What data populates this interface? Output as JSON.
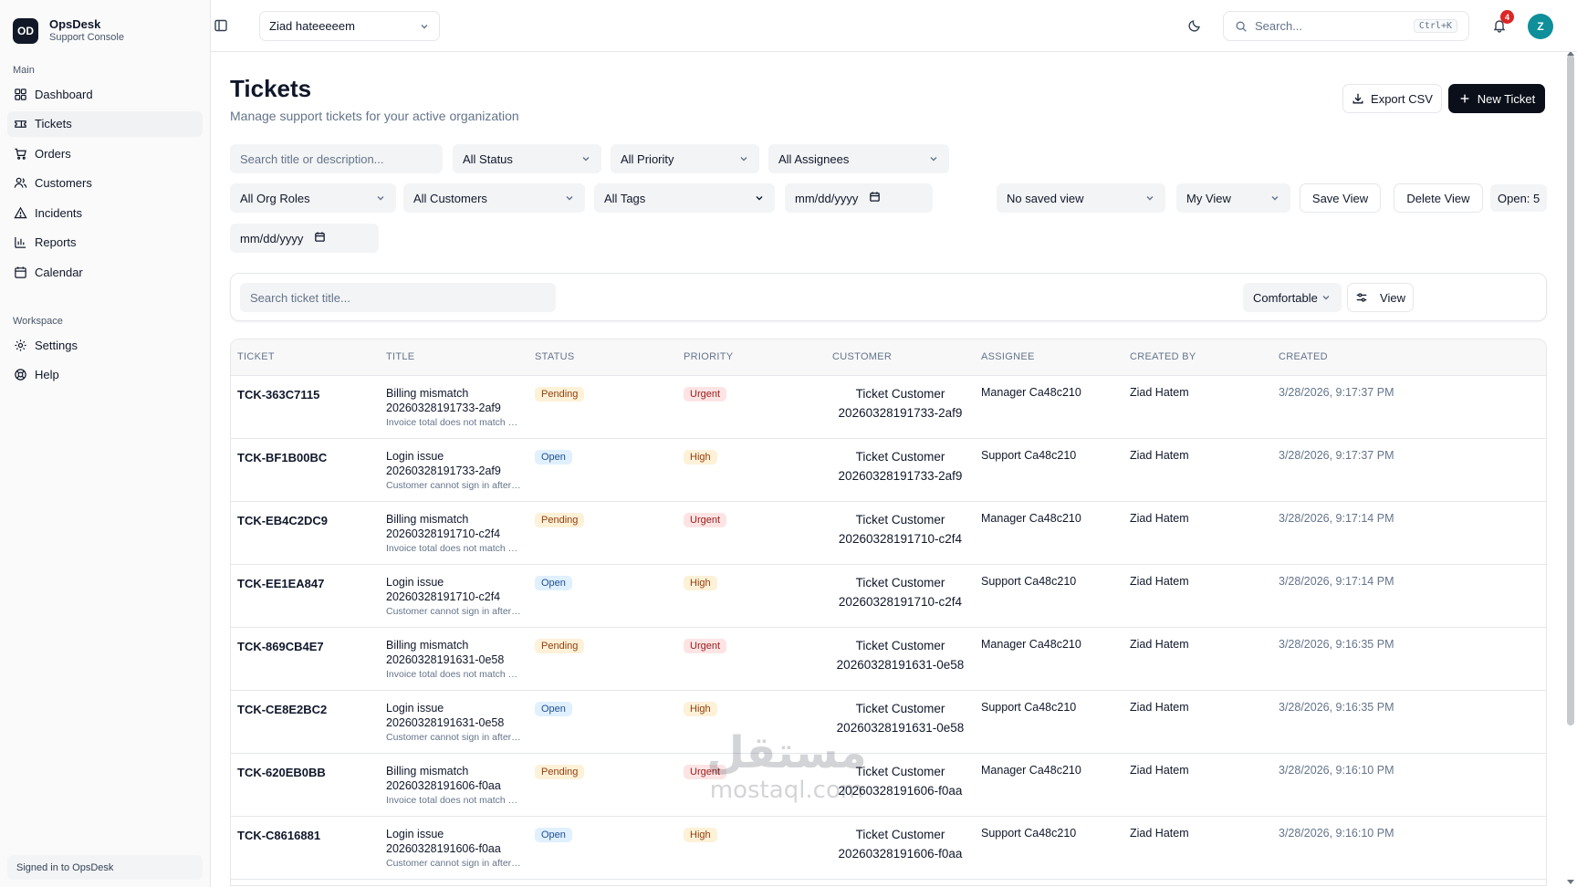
{
  "brand": {
    "logo_text": "OD",
    "name": "OpsDesk",
    "subtitle": "Support Console"
  },
  "sidebar": {
    "section_main": "Main",
    "main_items": [
      {
        "label": "Dashboard",
        "icon": "dashboard-icon"
      },
      {
        "label": "Tickets",
        "icon": "ticket-icon",
        "active": true
      },
      {
        "label": "Orders",
        "icon": "cart-icon"
      },
      {
        "label": "Customers",
        "icon": "users-icon"
      },
      {
        "label": "Incidents",
        "icon": "warning-icon"
      },
      {
        "label": "Reports",
        "icon": "bar-chart-icon"
      },
      {
        "label": "Calendar",
        "icon": "calendar-icon"
      }
    ],
    "section_workspace": "Workspace",
    "workspace_items": [
      {
        "label": "Settings",
        "icon": "gear-icon"
      },
      {
        "label": "Help",
        "icon": "help-icon"
      }
    ],
    "footer": "Signed in to OpsDesk"
  },
  "topbar": {
    "org_name": "Ziad hateeeeem",
    "search_placeholder": "Search...",
    "search_shortcut": "Ctrl+K",
    "notification_count": "4",
    "avatar_initial": "Z"
  },
  "page": {
    "title": "Tickets",
    "subtitle": "Manage support tickets for your active organization",
    "export_label": "Export CSV",
    "new_ticket_label": "New Ticket"
  },
  "filters": {
    "search_placeholder": "Search title or description...",
    "status": "All Status",
    "priority": "All Priority",
    "assignees": "All Assignees",
    "org_roles": "All Org Roles",
    "customers": "All Customers",
    "tags": "All Tags",
    "date_from": "mm/dd/yyyy",
    "date_to": "mm/dd/yyyy",
    "saved_view": "No saved view",
    "my_view": "My View",
    "save_view_label": "Save View",
    "delete_view_label": "Delete View",
    "open_count": "Open: 5"
  },
  "table_toolbar": {
    "search_placeholder": "Search ticket title...",
    "density": "Comfortable",
    "view_label": "View"
  },
  "table": {
    "columns": [
      "TICKET",
      "TITLE",
      "STATUS",
      "PRIORITY",
      "CUSTOMER",
      "ASSIGNEE",
      "CREATED BY",
      "CREATED"
    ],
    "rows": [
      {
        "ticket": "TCK-363C7115",
        "title": "Billing mismatch 20260328191733-2af9",
        "desc": "Invoice total does not match exp...",
        "status": "Pending",
        "priority": "Urgent",
        "customer_name": "Ticket Customer",
        "customer_id": "20260328191733-2af9",
        "assignee": "Manager Ca48c210",
        "created_by": "Ziad Hatem",
        "created": "3/28/2026, 9:17:37 PM"
      },
      {
        "ticket": "TCK-BF1B00BC",
        "title": "Login issue 20260328191733-2af9",
        "desc": "Customer cannot sign in after pa...",
        "status": "Open",
        "priority": "High",
        "customer_name": "Ticket Customer",
        "customer_id": "20260328191733-2af9",
        "assignee": "Support Ca48c210",
        "created_by": "Ziad Hatem",
        "created": "3/28/2026, 9:17:37 PM"
      },
      {
        "ticket": "TCK-EB4C2DC9",
        "title": "Billing mismatch 20260328191710-c2f4",
        "desc": "Invoice total does not match exp...",
        "status": "Pending",
        "priority": "Urgent",
        "customer_name": "Ticket Customer",
        "customer_id": "20260328191710-c2f4",
        "assignee": "Manager Ca48c210",
        "created_by": "Ziad Hatem",
        "created": "3/28/2026, 9:17:14 PM"
      },
      {
        "ticket": "TCK-EE1EA847",
        "title": "Login issue 20260328191710-c2f4",
        "desc": "Customer cannot sign in after pa...",
        "status": "Open",
        "priority": "High",
        "customer_name": "Ticket Customer",
        "customer_id": "20260328191710-c2f4",
        "assignee": "Support Ca48c210",
        "created_by": "Ziad Hatem",
        "created": "3/28/2026, 9:17:14 PM"
      },
      {
        "ticket": "TCK-869CB4E7",
        "title": "Billing mismatch 20260328191631-0e58",
        "desc": "Invoice total does not match exp...",
        "status": "Pending",
        "priority": "Urgent",
        "customer_name": "Ticket Customer",
        "customer_id": "20260328191631-0e58",
        "assignee": "Manager Ca48c210",
        "created_by": "Ziad Hatem",
        "created": "3/28/2026, 9:16:35 PM"
      },
      {
        "ticket": "TCK-CE8E2BC2",
        "title": "Login issue 20260328191631-0e58",
        "desc": "Customer cannot sign in after pa...",
        "status": "Open",
        "priority": "High",
        "customer_name": "Ticket Customer",
        "customer_id": "20260328191631-0e58",
        "assignee": "Support Ca48c210",
        "created_by": "Ziad Hatem",
        "created": "3/28/2026, 9:16:35 PM"
      },
      {
        "ticket": "TCK-620EB0BB",
        "title": "Billing mismatch 20260328191606-f0aa",
        "desc": "Invoice total does not match exp...",
        "status": "Pending",
        "priority": "Urgent",
        "customer_name": "Ticket Customer",
        "customer_id": "20260328191606-f0aa",
        "assignee": "Manager Ca48c210",
        "created_by": "Ziad Hatem",
        "created": "3/28/2026, 9:16:10 PM"
      },
      {
        "ticket": "TCK-C8616881",
        "title": "Login issue 20260328191606-f0aa",
        "desc": "Customer cannot sign in after pa...",
        "status": "Open",
        "priority": "High",
        "customer_name": "Ticket Customer",
        "customer_id": "20260328191606-f0aa",
        "assignee": "Support Ca48c210",
        "created_by": "Ziad Hatem",
        "created": "3/28/2026, 9:16:10 PM"
      }
    ]
  },
  "watermark": {
    "arabic": "مستقل",
    "latin": "mostaql.com"
  }
}
